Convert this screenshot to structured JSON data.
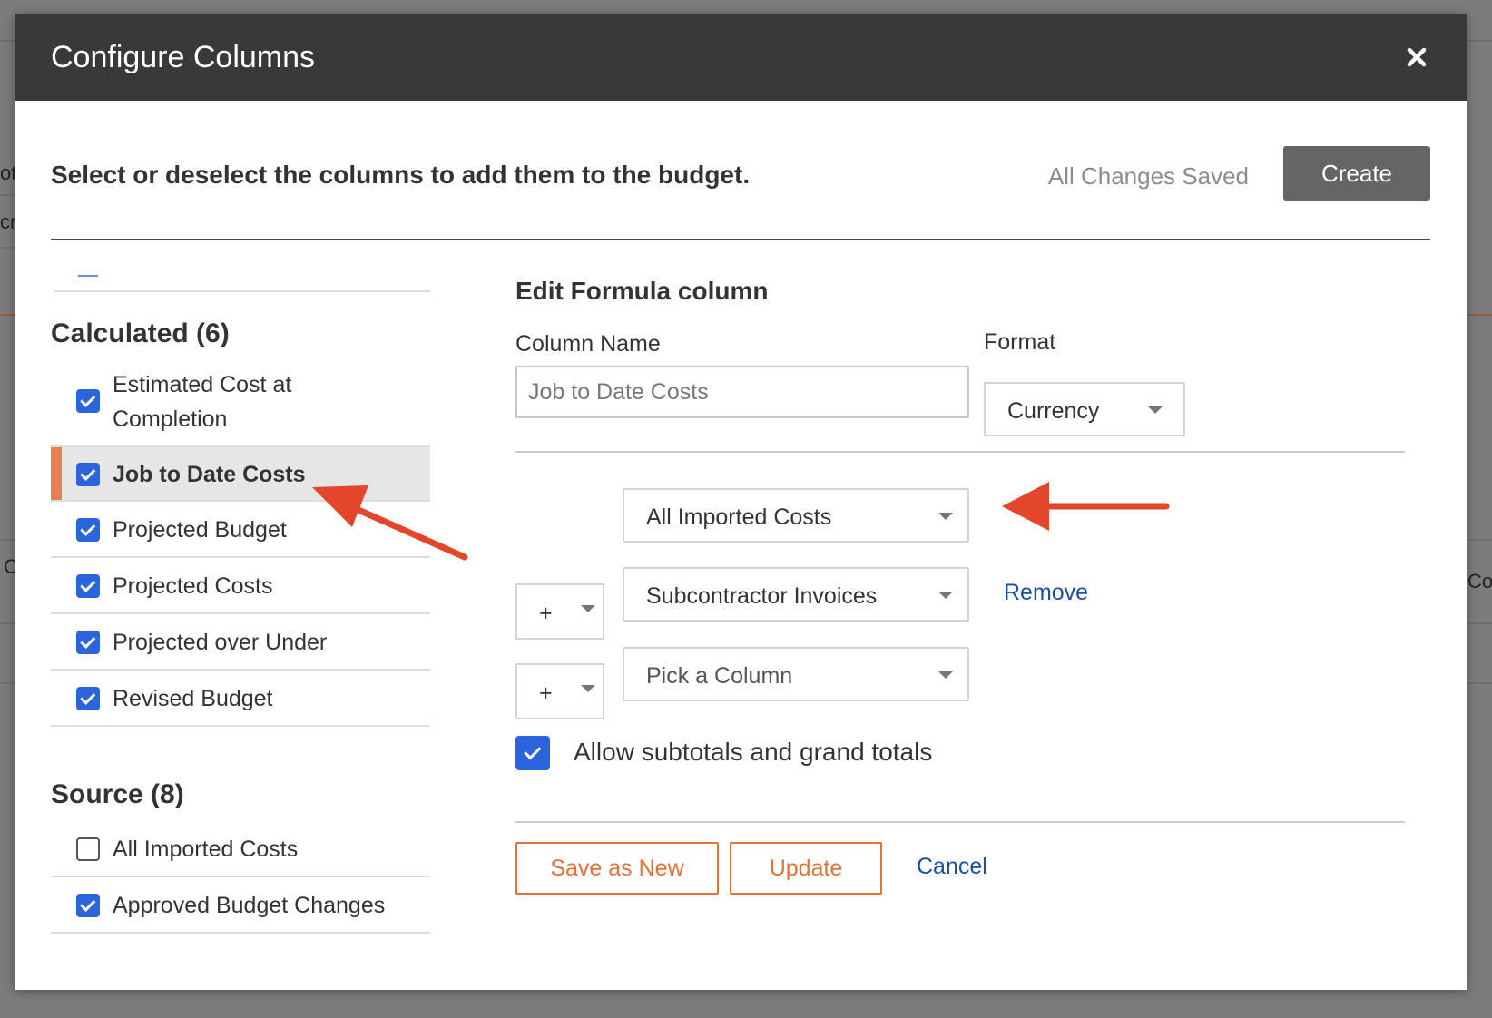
{
  "modal": {
    "title": "Configure Columns",
    "close_icon": "close-icon"
  },
  "subheader": {
    "instruction": "Select or deselect the columns to add them to the budget.",
    "status": "All Changes Saved",
    "create_label": "Create"
  },
  "left_panel": {
    "calculated": {
      "title": "Calculated (6)",
      "items": [
        {
          "label": "Estimated Cost at Completion",
          "checked": true
        },
        {
          "label": "Job to Date Costs",
          "checked": true,
          "selected": true
        },
        {
          "label": "Projected Budget",
          "checked": true
        },
        {
          "label": "Projected Costs",
          "checked": true
        },
        {
          "label": "Projected over Under",
          "checked": true
        },
        {
          "label": "Revised Budget",
          "checked": true
        }
      ]
    },
    "source": {
      "title": "Source (8)",
      "items": [
        {
          "label": "All Imported Costs",
          "checked": false
        },
        {
          "label": "Approved Budget Changes",
          "checked": true
        }
      ]
    }
  },
  "editor": {
    "title": "Edit Formula column",
    "column_name_label": "Column Name",
    "column_name_placeholder": "Job to Date Costs",
    "format_label": "Format",
    "format_value": "Currency",
    "operands": [
      {
        "operator": null,
        "column": "All Imported Costs"
      },
      {
        "operator": "+",
        "column": "Subcontractor Invoices",
        "remove_label": "Remove"
      },
      {
        "operator": "+",
        "column": "Pick a Column"
      }
    ],
    "subtotals_label": "Allow subtotals and grand totals",
    "subtotals_checked": true,
    "save_as_new_label": "Save as New",
    "update_label": "Update",
    "cancel_label": "Cancel"
  },
  "background": {
    "fragment_1": "oti",
    "fragment_2": "cri",
    "fragment_3": "C",
    "fragment_4": "Co"
  },
  "colors": {
    "header_bg": "#38393b",
    "checkbox_blue": "#2c64dd",
    "accent_orange": "#e0733d",
    "annotation_red": "#e3462b",
    "link_blue": "#1d4fa0"
  }
}
